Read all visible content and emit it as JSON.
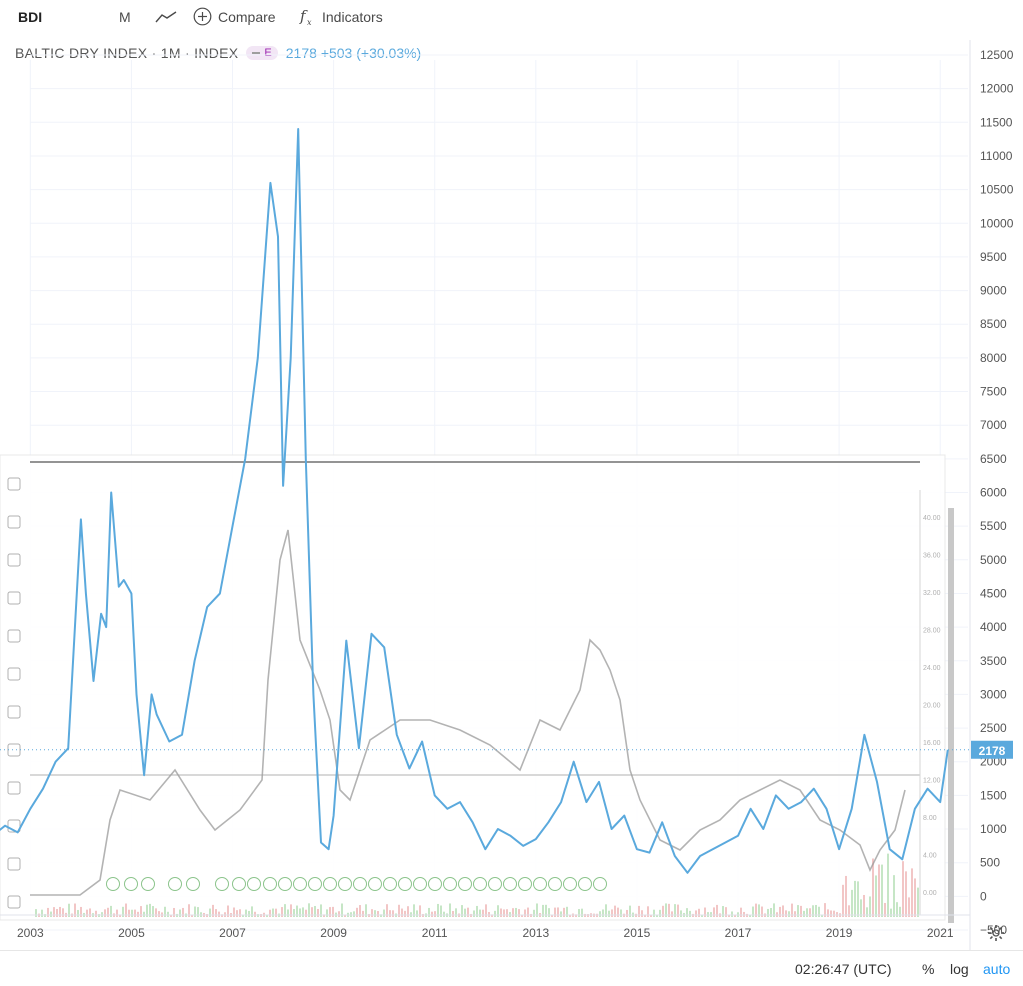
{
  "toolbar": {
    "symbol": "BDI",
    "interval": "M",
    "compare_label": "Compare",
    "indicators_label": "Indicators"
  },
  "legend": {
    "title": "BALTIC DRY INDEX · 1M · INDEX",
    "badge": "E",
    "value": "2178",
    "change": "+503 (+30.03%)"
  },
  "status_bar": {
    "time": "02:26:47 (UTC)",
    "percent": "%",
    "log": "log",
    "auto": "auto"
  },
  "colors": {
    "line": "#5aa9dd",
    "price_tag": "#5aa9dd",
    "axis_text": "#555555",
    "grid": "#f0f3fa",
    "overlay_candle": "#9a9a9a"
  },
  "chart_data": {
    "type": "line",
    "series": [
      {
        "x": [
          2002.0,
          2002.25,
          2002.5,
          2002.75,
          2003.0,
          2003.25,
          2003.5,
          2003.75,
          2004.0,
          2004.1,
          2004.25,
          2004.4,
          2004.5,
          2004.6,
          2004.75,
          2004.85,
          2005.0,
          2005.1,
          2005.25,
          2005.4,
          2005.5,
          2005.75,
          2006.0,
          2006.25,
          2006.5,
          2006.75,
          2007.0,
          2007.25,
          2007.5,
          2007.75,
          2007.9,
          2008.0,
          2008.15,
          2008.3,
          2008.45,
          2008.6,
          2008.75,
          2008.9,
          2009.0,
          2009.25,
          2009.5,
          2009.75,
          2010.0,
          2010.25,
          2010.5,
          2010.75,
          2011.0,
          2011.25,
          2011.5,
          2011.75,
          2012.0,
          2012.25,
          2012.5,
          2012.75,
          2013.0,
          2013.25,
          2013.5,
          2013.75,
          2014.0,
          2014.25,
          2014.5,
          2014.75,
          2015.0,
          2015.25,
          2015.5,
          2015.75,
          2016.0,
          2016.25,
          2016.5,
          2016.75,
          2017.0,
          2017.25,
          2017.5,
          2017.75,
          2018.0,
          2018.25,
          2018.5,
          2018.75,
          2019.0,
          2019.25,
          2019.5,
          2019.75,
          2020.0,
          2020.25,
          2020.5,
          2020.75,
          2021.0,
          2021.15
        ],
        "y": [
          1000,
          900,
          1050,
          950,
          1300,
          1600,
          2000,
          2200,
          5600,
          4500,
          3200,
          4200,
          4000,
          6000,
          4600,
          4700,
          4500,
          3000,
          1800,
          3000,
          2700,
          2300,
          2400,
          3500,
          4300,
          4500,
          5500,
          6500,
          8000,
          10600,
          9800,
          6100,
          8000,
          11400,
          6500,
          3000,
          800,
          700,
          1200,
          3800,
          2200,
          3900,
          3700,
          2400,
          1900,
          2300,
          1500,
          1300,
          1400,
          1100,
          700,
          1000,
          900,
          750,
          850,
          1100,
          1400,
          2000,
          1400,
          1700,
          1000,
          1200,
          700,
          650,
          1100,
          600,
          350,
          600,
          700,
          800,
          900,
          1300,
          1000,
          1500,
          1300,
          1400,
          1600,
          1300,
          700,
          1300,
          2400,
          1700,
          700,
          550,
          1300,
          1600,
          1400,
          2178
        ]
      }
    ],
    "x_tick_labels": [
      "2003",
      "2005",
      "2007",
      "2009",
      "2011",
      "2013",
      "2015",
      "2017",
      "2019",
      "2021"
    ],
    "y_tick_labels": [
      "12500",
      "12000",
      "11500",
      "11000",
      "10500",
      "10000",
      "9500",
      "9000",
      "8500",
      "8000",
      "7500",
      "7000",
      "6500",
      "6000",
      "5500",
      "5000",
      "4500",
      "4000",
      "3500",
      "3000",
      "2500",
      "2000",
      "1500",
      "1000",
      "500",
      "0",
      "−500"
    ],
    "ylim": [
      -500,
      12500
    ],
    "xlim": [
      2002.4,
      2021.55
    ],
    "last_value": "2178",
    "overlay_y_labels": [
      "40.00",
      "36.00",
      "32.00",
      "28.00",
      "24.00",
      "20.00",
      "16.00",
      "12.00",
      "8.00",
      "4.00",
      "0.00"
    ]
  }
}
